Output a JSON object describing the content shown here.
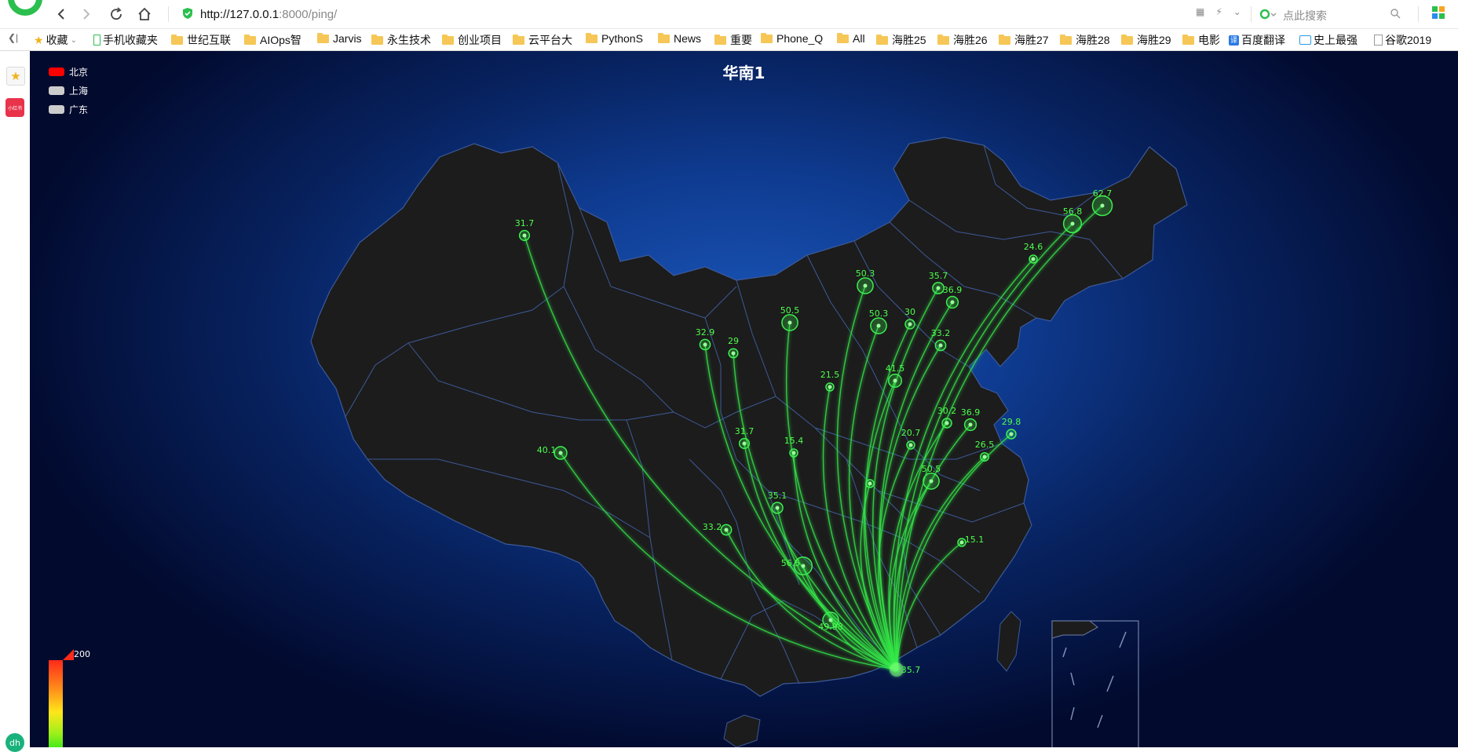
{
  "browser": {
    "url_host": "http://127.0.0.1",
    "url_rest": ":8000/ping/",
    "search_placeholder": "点此搜索"
  },
  "bookmarks": [
    {
      "label": "收藏",
      "icon": "star-icon"
    },
    {
      "label": "手机收藏夹",
      "icon": "phone-icon"
    },
    {
      "label": "世纪互联",
      "icon": "folder-icon"
    },
    {
      "label": "AIOps智",
      "icon": "folder-icon"
    },
    {
      "label": "Jarvis",
      "icon": "folder-icon"
    },
    {
      "label": "永生技术",
      "icon": "folder-icon"
    },
    {
      "label": "创业项目",
      "icon": "folder-icon"
    },
    {
      "label": "云平台大",
      "icon": "folder-icon"
    },
    {
      "label": "PythonS",
      "icon": "folder-icon"
    },
    {
      "label": "News",
      "icon": "folder-icon"
    },
    {
      "label": "重要",
      "icon": "folder-icon"
    },
    {
      "label": "Phone_Q",
      "icon": "folder-icon"
    },
    {
      "label": "All",
      "icon": "folder-icon"
    },
    {
      "label": "海胜25",
      "icon": "folder-icon"
    },
    {
      "label": "海胜26",
      "icon": "folder-icon"
    },
    {
      "label": "海胜27",
      "icon": "folder-icon"
    },
    {
      "label": "海胜28",
      "icon": "folder-icon"
    },
    {
      "label": "海胜29",
      "icon": "folder-icon"
    },
    {
      "label": "电影",
      "icon": "folder-icon"
    },
    {
      "label": "百度翻译",
      "icon": "translate-icon"
    },
    {
      "label": "史上最强",
      "icon": "tv-icon"
    },
    {
      "label": "谷歌2019",
      "icon": "doc-icon"
    }
  ],
  "sidebar": {
    "app_badge": "小红书"
  },
  "map": {
    "title": "华南1",
    "legend": [
      {
        "label": "北京",
        "color": "#ff0000"
      },
      {
        "label": "上海",
        "color": "#cccccc"
      },
      {
        "label": "广东",
        "color": "#cccccc"
      }
    ],
    "visual_map_max": "200",
    "source_value": "35.7",
    "targets": [
      {
        "value": "31.7"
      },
      {
        "value": "62.7"
      },
      {
        "value": "56.8"
      },
      {
        "value": "24.6"
      },
      {
        "value": "50.3"
      },
      {
        "value": "35.7"
      },
      {
        "value": "36.9"
      },
      {
        "value": "50.3"
      },
      {
        "value": "30"
      },
      {
        "value": "50.5"
      },
      {
        "value": "32.9"
      },
      {
        "value": "29"
      },
      {
        "value": "33.2"
      },
      {
        "value": "21.5"
      },
      {
        "value": "41.5"
      },
      {
        "value": "30.2"
      },
      {
        "value": "36.9"
      },
      {
        "value": "29.8"
      },
      {
        "value": "20.7"
      },
      {
        "value": "26.5"
      },
      {
        "value": "31.7"
      },
      {
        "value": "15.4"
      },
      {
        "value": "40.1"
      },
      {
        "value": "50.5"
      },
      {
        "value": "35.1"
      },
      {
        "value": "33.2"
      },
      {
        "value": "56.5"
      },
      {
        "value": "15.1"
      },
      {
        "value": "49.98"
      },
      {
        "value": ""
      }
    ]
  }
}
